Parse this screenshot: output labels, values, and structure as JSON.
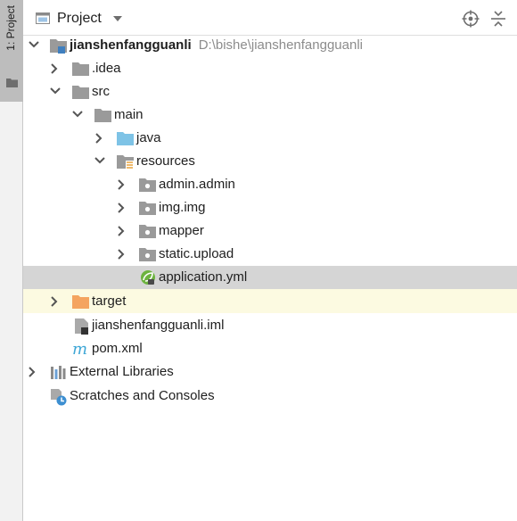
{
  "sidebar": {
    "tab_label": "1: Project"
  },
  "header": {
    "title": "Project"
  },
  "tree": {
    "root": {
      "name": "jianshenfangguanli",
      "path": "D:\\bishe\\jianshenfangguanli"
    },
    "idea": ".idea",
    "src": "src",
    "main": "main",
    "java": "java",
    "resources": "resources",
    "admin": "admin.admin",
    "img": "img.img",
    "mapper": "mapper",
    "static": "static.upload",
    "application": "application.yml",
    "target": "target",
    "iml": "jianshenfangguanli.iml",
    "pom": "pom.xml",
    "libraries": "External Libraries",
    "scratches": "Scratches and Consoles"
  },
  "colors": {
    "selected_row": "#d5d5d5",
    "excluded_row": "#fcfae1",
    "target_folder": "#f4a460",
    "source_folder": "#7ec3e6",
    "maven_icon": "#3ea7d6"
  }
}
